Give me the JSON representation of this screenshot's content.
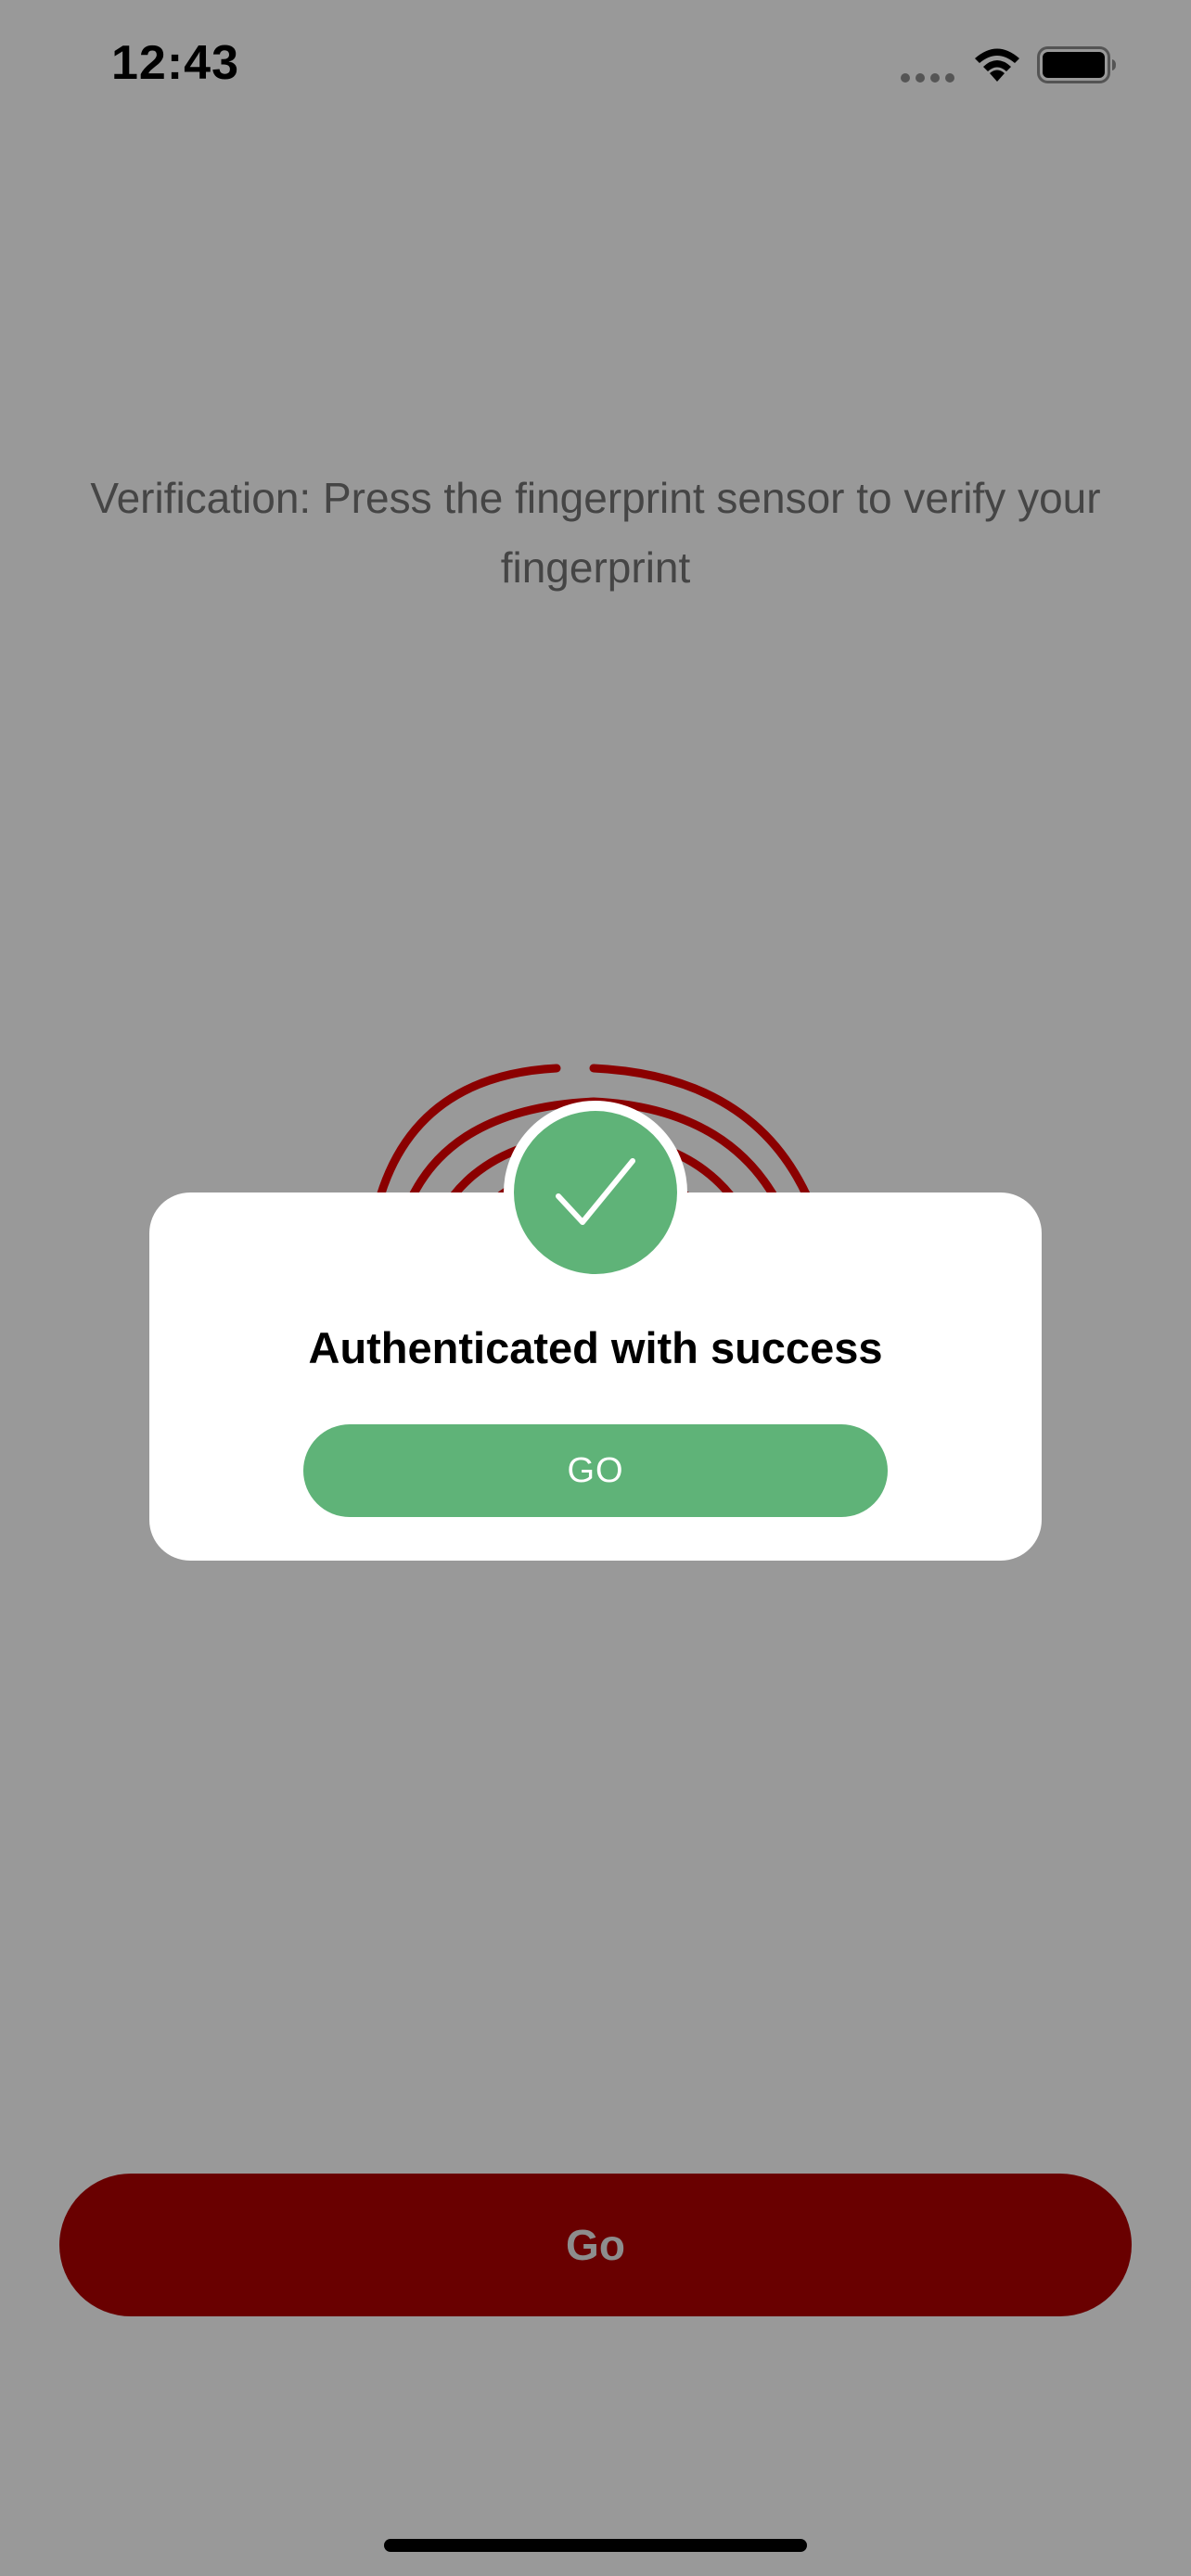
{
  "status_bar": {
    "time": "12:43"
  },
  "screen": {
    "instruction": "Verification: Press the fingerprint sensor to verify your fingerprint",
    "primary_button_label": "Go",
    "fingerprint_icon": "fingerprint-icon"
  },
  "modal": {
    "badge_icon": "check-icon",
    "message": "Authenticated with success",
    "button_label": "GO"
  },
  "colors": {
    "background_dim": "#999999",
    "brand_dark_red": "#690000",
    "fingerprint_red": "#8b0000",
    "success_green": "#5fb378",
    "modal_background": "#ffffff"
  }
}
